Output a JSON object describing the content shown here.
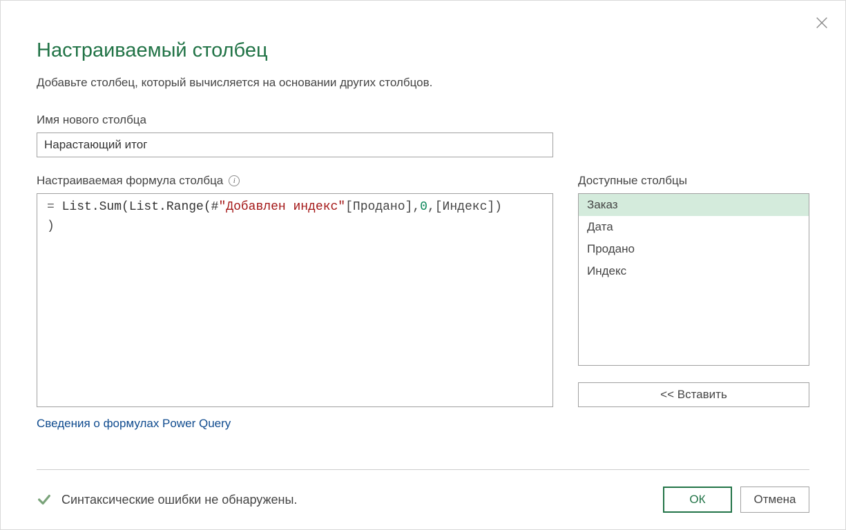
{
  "dialog": {
    "title": "Настраиваемый столбец",
    "subtitle": "Добавьте столбец, который вычисляется на основании других столбцов.",
    "new_column_label": "Имя нового столбца",
    "new_column_value": "Нарастающий итог",
    "formula_label": "Настраиваемая формула столбца",
    "formula": {
      "raw": "= List.Sum(List.Range(#\"Добавлен индекс\"[Продано],0,[Индекс]))",
      "tokens": {
        "eq": "= ",
        "t1": "List.Sum(List.Range(",
        "hash": "#",
        "str": "\"Добавлен индекс\"",
        "t2": "[Продано],",
        "num": "0",
        "t3": ",[Индекс])\n)"
      }
    },
    "formula_link": "Сведения о формулах Power Query",
    "available_label": "Доступные столбцы",
    "available_columns": [
      "Заказ",
      "Дата",
      "Продано",
      "Индекс"
    ],
    "selected_column_index": 0,
    "insert_label": "<< Вставить",
    "status_text": "Синтаксические ошибки не обнаружены.",
    "ok_label": "ОК",
    "cancel_label": "Отмена"
  }
}
